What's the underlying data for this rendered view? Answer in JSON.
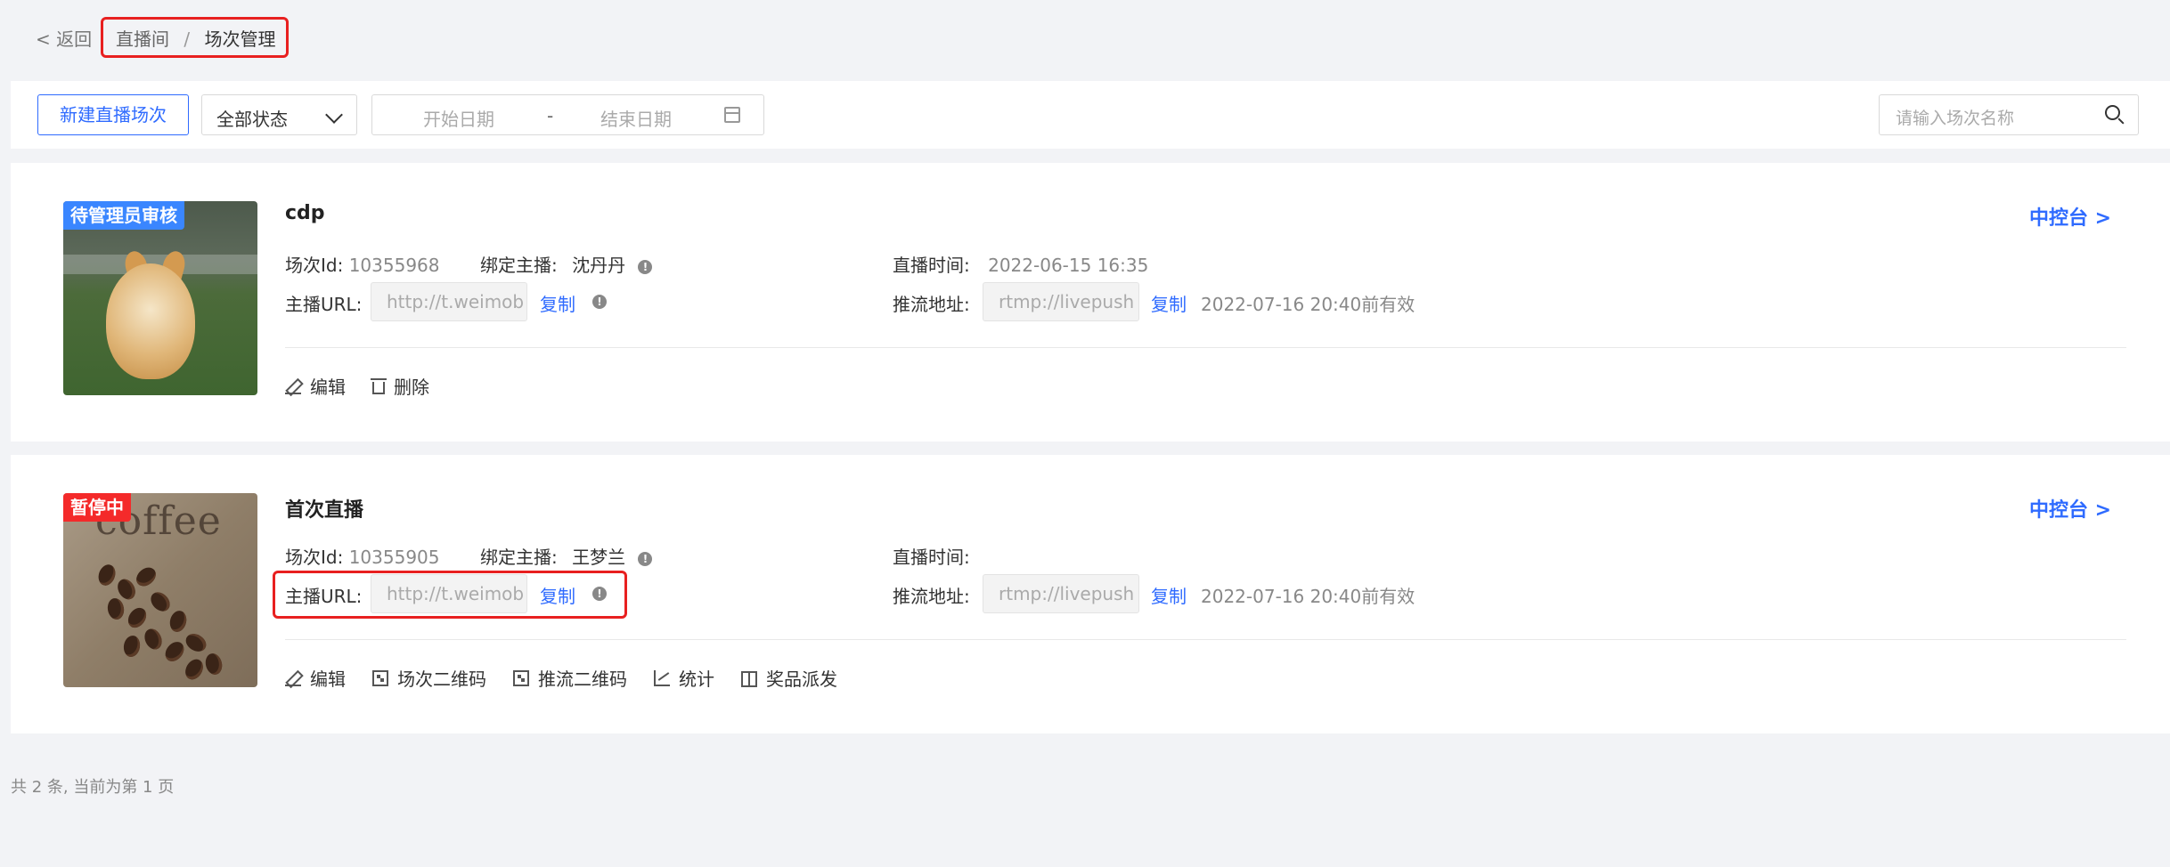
{
  "header": {
    "back_label": "< 返回",
    "breadcrumb": [
      "直播间",
      "/",
      "场次管理"
    ]
  },
  "toolbar": {
    "new_button": "新建直播场次",
    "status_select": "全部状态",
    "start_date_placeholder": "开始日期",
    "date_separator": "-",
    "end_date_placeholder": "结束日期",
    "search_placeholder": "请输入场次名称"
  },
  "cards": [
    {
      "badge": "待管理员审核",
      "title": "cdp",
      "console_link": "中控台 >",
      "session_id_label": "场次Id:",
      "session_id": "10355968",
      "anchor_label": "绑定主播:",
      "anchor_name": "沈丹丹",
      "live_time_label": "直播时间:",
      "live_time": "2022-06-15 16:35",
      "anchor_url_label": "主播URL:",
      "anchor_url": "http://t.weimob",
      "copy_label": "复制",
      "push_url_label": "推流地址:",
      "push_url": "rtmp://livepush",
      "push_copy_label": "复制",
      "valid_until": "2022-07-16 20:40前有效",
      "actions": [
        "编辑",
        "删除"
      ]
    },
    {
      "badge": "暂停中",
      "title": "首次直播",
      "console_link": "中控台 >",
      "session_id_label": "场次Id:",
      "session_id": "10355905",
      "anchor_label": "绑定主播:",
      "anchor_name": "王梦兰",
      "live_time_label": "直播时间:",
      "live_time": "",
      "anchor_url_label": "主播URL:",
      "anchor_url": "http://t.weimob",
      "copy_label": "复制",
      "push_url_label": "推流地址:",
      "push_url": "rtmp://livepush",
      "push_copy_label": "复制",
      "valid_until": "2022-07-16 20:40前有效",
      "actions": [
        "编辑",
        "场次二维码",
        "推流二维码",
        "统计",
        "奖品派发"
      ],
      "thumb_text": "coffee"
    }
  ],
  "footer": {
    "summary": "共 2 条, 当前为第 1 页"
  },
  "colors": {
    "accent": "#2f6bff",
    "badge_review": "#3a86ff",
    "badge_paused": "#f42a2a",
    "highlight": "#e82020",
    "background": "#f2f3f6"
  }
}
